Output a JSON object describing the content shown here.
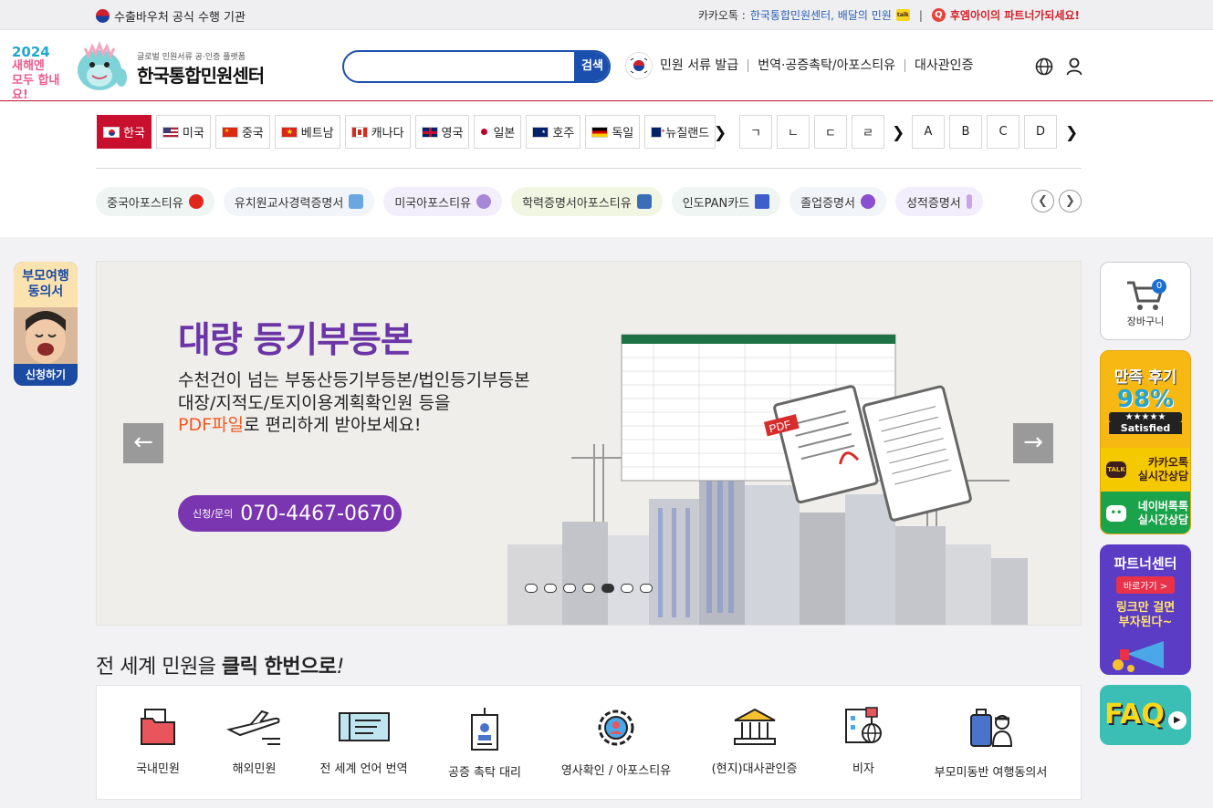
{
  "topbar": {
    "left_text": "수출바우처 공식 수행 기관",
    "kakao_prefix": "카카오톡 :",
    "kakao_link": "한국통합민원센터, 배달의 민원",
    "kakao_badge": "talk",
    "separator": "|",
    "partner_text": "후엠아이의 파트너가되세요!"
  },
  "header": {
    "badge_year": "2024",
    "badge_line2": "새해엔",
    "badge_line3": "모두 합내요!",
    "logo_sub": "글로벌 민원서류 공·인증 플랫폼",
    "logo_main": "한국통합민원센터",
    "search_placeholder": "",
    "search_button": "검색",
    "nav": [
      "민원 서류 발급",
      "번역·공증촉탁/아포스티유",
      "대사관인증"
    ]
  },
  "nations": [
    {
      "label": "한국",
      "active": true
    },
    {
      "label": "미국",
      "active": false
    },
    {
      "label": "중국",
      "active": false
    },
    {
      "label": "베트남",
      "active": false
    },
    {
      "label": "캐나다",
      "active": false
    },
    {
      "label": "영국",
      "active": false
    },
    {
      "label": "일본",
      "active": false
    },
    {
      "label": "호주",
      "active": false
    },
    {
      "label": "독일",
      "active": false
    },
    {
      "label": "뉴질랜드",
      "active": false
    }
  ],
  "hangul_letters": [
    "ㄱ",
    "ㄴ",
    "ㄷ",
    "ㄹ"
  ],
  "latin_letters": [
    "A",
    "B",
    "C",
    "D"
  ],
  "chevron": "❯",
  "tags": [
    {
      "label": "중국아포스티유",
      "bg": "#eef5f2",
      "icon_color": "#e1261c"
    },
    {
      "label": "유치원교사경력증명서",
      "bg": "#f1f4f9",
      "icon_color": "#6aa7e0"
    },
    {
      "label": "미국아포스티유",
      "bg": "#f3eefb",
      "icon_color": "#a788d8"
    },
    {
      "label": "학력증명서아포스티유",
      "bg": "#f1f6e2",
      "icon_color": "#3a6fb5"
    },
    {
      "label": "인도PAN카드",
      "bg": "#eef5f2",
      "icon_color": "#3c5fc9"
    },
    {
      "label": "졸업증명서",
      "bg": "#f1f4f9",
      "icon_color": "#8a4fd0"
    },
    {
      "label": "성적증명서",
      "bg": "#f3eefb",
      "icon_color": "#c9a3e6"
    }
  ],
  "banner": {
    "title": "대량 등기부등본",
    "line1": "수천건이 넘는 부동산등기부등본/법인등기부등본",
    "line2": "대장/지적도/토지이용계획확인원 등을",
    "line3_hl": "PDF파일",
    "line3_rest": "로 편리하게 받아보세요!",
    "phone_label": "신청/문의",
    "phone_number": "070-4467-0670",
    "slide_count": 7,
    "active_slide": 5,
    "pdf_label": "PDF"
  },
  "left_float": {
    "title_line1": "부모여행",
    "title_line2": "동의서",
    "button": "신청하기"
  },
  "right_float": {
    "cart_label": "장바구니",
    "cart_count": "0",
    "review_title": "만족 후기",
    "review_pct": "98%",
    "review_stars": "★★★★★",
    "review_sat": "Satisfied",
    "kakao_line1": "카카오톡",
    "kakao_line2": "실시간상담",
    "kakao_icon": "TALK",
    "naver_line1": "네이버톡톡",
    "naver_line2": "실시간상담",
    "partner_title": "파트너센터",
    "partner_go": "바로가기 >",
    "partner_line1": "링크만 걸면",
    "partner_line2": "부자된다~",
    "faq": "FAQ"
  },
  "services_title_normal": "전 세계 민원을 ",
  "services_title_bold": "클릭 한번으로",
  "services_title_end": "!",
  "services": [
    {
      "label": "국내민원"
    },
    {
      "label": "해외민원"
    },
    {
      "label": "전 세계 언어 번역"
    },
    {
      "label": "공증 촉탁 대리"
    },
    {
      "label": "영사확인 / 아포스티유"
    },
    {
      "label": "(현지)대사관인증"
    },
    {
      "label": "비자"
    },
    {
      "label": "부모미동반 여행동의서"
    }
  ],
  "colors": {
    "brand_red": "#c8102e",
    "brand_blue": "#1b4fae",
    "banner_purple": "#6b35a8",
    "banner_orange": "#f15a22"
  }
}
